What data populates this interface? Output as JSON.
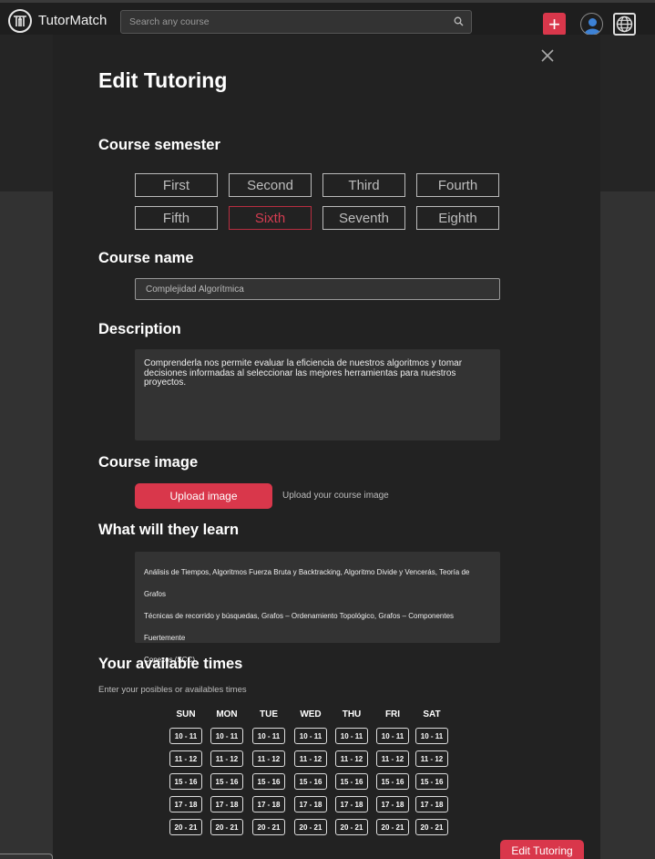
{
  "navbar": {
    "brand": "TutorMatch",
    "search_placeholder": "Search any course",
    "add_label": "+"
  },
  "modal": {
    "title": "Edit Tutoring",
    "semester": {
      "title": "Course semester",
      "options": [
        "First",
        "Second",
        "Third",
        "Fourth",
        "Fifth",
        "Sixth",
        "Seventh",
        "Eighth"
      ],
      "selected": "Sixth"
    },
    "course_name": {
      "title": "Course name",
      "value": "Complejidad Algorítmica"
    },
    "description": {
      "title": "Description",
      "value": "Comprenderla nos permite evaluar la eficiencia de nuestros algoritmos y tomar decisiones informadas al seleccionar las mejores herramientas para nuestros proyectos."
    },
    "course_image": {
      "title": "Course image",
      "button": "Upload image",
      "hint": "Upload your course image"
    },
    "learn": {
      "title": "What will they learn",
      "lines": [
        "Análisis de Tiempos, Algoritmos Fuerza Bruta y Backtracking, Algoritmo Divide y Vencerás, Teoría de Grafos",
        "Técnicas de recorrido y búsquedas, Grafos – Ordenamiento Topológico, Grafos – Componentes Fuertemente",
        "Conexos (SCC)"
      ]
    },
    "times": {
      "title": "Your available times",
      "hint": "Enter your posibles or availables times",
      "days": [
        "SUN",
        "MON",
        "TUE",
        "WED",
        "THU",
        "FRI",
        "SAT"
      ],
      "slots": [
        "10 - 11",
        "11 - 12",
        "15 - 16",
        "17 - 18",
        "20 - 21"
      ]
    },
    "submit": "Edit Tutoring"
  },
  "colors": {
    "accent": "#d9374b",
    "selected_text": "#d33c50",
    "modal_bg": "#222222",
    "field_bg": "#333333"
  }
}
